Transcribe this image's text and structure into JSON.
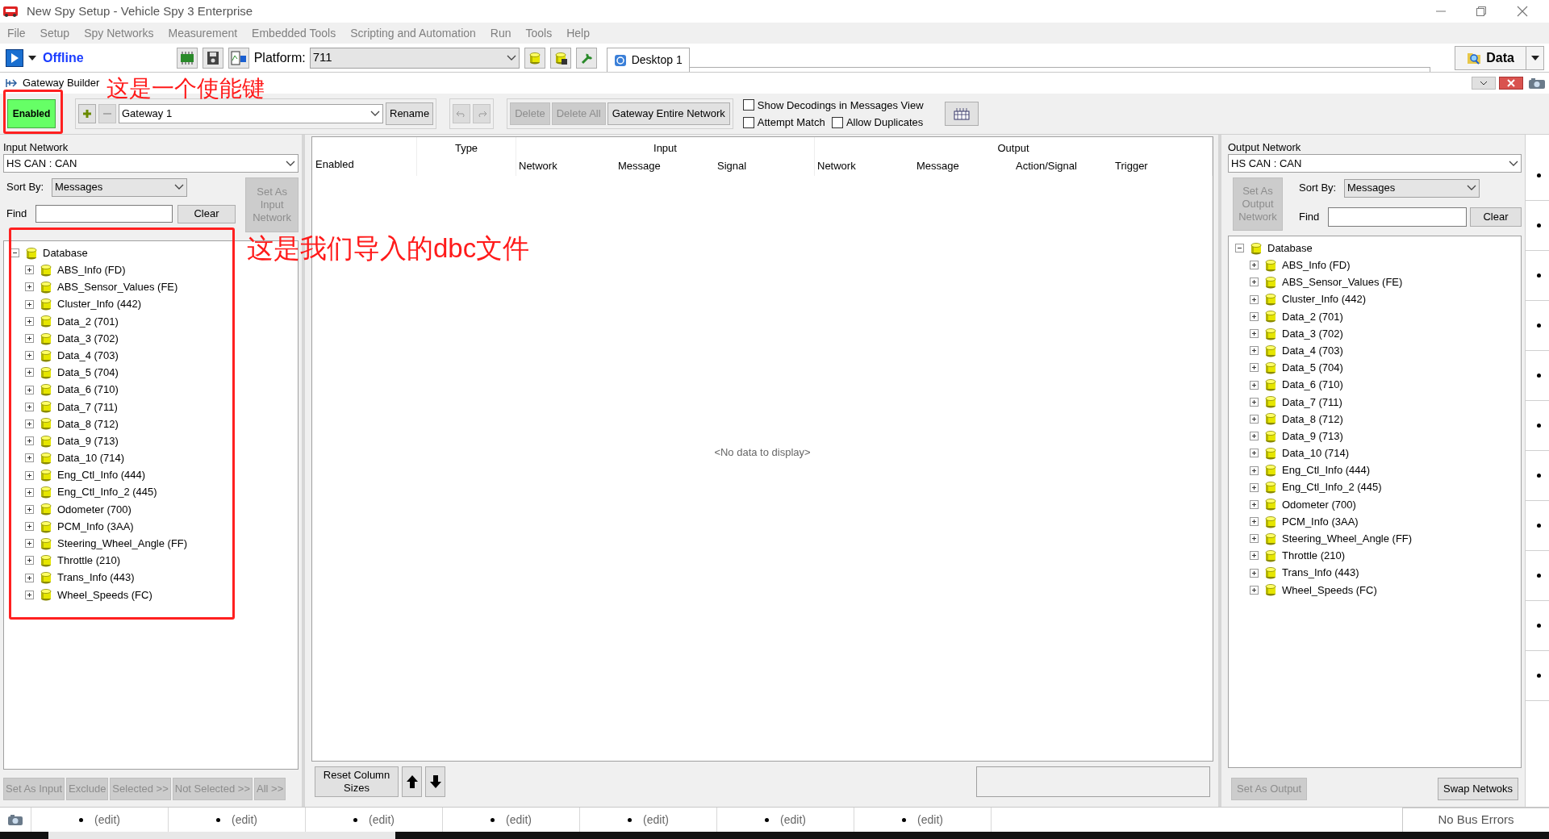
{
  "window": {
    "title": "New Spy Setup - Vehicle Spy 3 Enterprise"
  },
  "menu": [
    "File",
    "Setup",
    "Spy Networks",
    "Measurement",
    "Embedded Tools",
    "Scripting and Automation",
    "Run",
    "Tools",
    "Help"
  ],
  "toolbar": {
    "mode": "Offline",
    "platform_label": "Platform:",
    "platform": "711",
    "desktop_tab": "Desktop 1",
    "data_button": "Data"
  },
  "panel": {
    "title": "Gateway Builder"
  },
  "controls": {
    "enabled": {
      "label": "Enabled",
      "on": true
    },
    "gateway": "Gateway 1",
    "rename": "Rename",
    "buttons": [
      {
        "label": "Delete",
        "disabled": true
      },
      {
        "label": "Delete All",
        "disabled": true
      },
      {
        "label": "Gateway Entire Network",
        "disabled": false
      }
    ],
    "options": [
      {
        "label": "Show Decodings in Messages View",
        "checked": false
      },
      {
        "label": "Attempt Match",
        "checked": false
      },
      {
        "label": "Allow Duplicates",
        "checked": false
      }
    ]
  },
  "input_network": {
    "title": "Input Network",
    "network": "HS CAN : CAN",
    "sort_label": "Sort By:",
    "sort": "Messages",
    "set_button": {
      "label": "Set As Input Network",
      "disabled": true
    },
    "find_label": "Find",
    "clear": "Clear",
    "tree": {
      "label": "Database",
      "expanded": true,
      "children": [
        {
          "label": "ABS_Info (FD)",
          "expanded": false
        },
        {
          "label": "ABS_Sensor_Values (FE)",
          "expanded": false
        },
        {
          "label": "Cluster_Info (442)",
          "expanded": false
        },
        {
          "label": "Data_2 (701)",
          "expanded": false
        },
        {
          "label": "Data_3 (702)",
          "expanded": false
        },
        {
          "label": "Data_4 (703)",
          "expanded": false
        },
        {
          "label": "Data_5 (704)",
          "expanded": false
        },
        {
          "label": "Data_6 (710)",
          "expanded": false
        },
        {
          "label": "Data_7 (711)",
          "expanded": false
        },
        {
          "label": "Data_8 (712)",
          "expanded": false
        },
        {
          "label": "Data_9 (713)",
          "expanded": false
        },
        {
          "label": "Data_10 (714)",
          "expanded": false
        },
        {
          "label": "Eng_Ctl_Info (444)",
          "expanded": false
        },
        {
          "label": "Eng_Ctl_Info_2 (445)",
          "expanded": false
        },
        {
          "label": "Odometer (700)",
          "expanded": false
        },
        {
          "label": "PCM_Info (3AA)",
          "expanded": false
        },
        {
          "label": "Steering_Wheel_Angle (FF)",
          "expanded": false
        },
        {
          "label": "Throttle (210)",
          "expanded": false
        },
        {
          "label": "Trans_Info (443)",
          "expanded": false
        },
        {
          "label": "Wheel_Speeds (FC)",
          "expanded": false
        }
      ]
    },
    "buttons": [
      {
        "label": "Set As Input",
        "disabled": true
      },
      {
        "label": "Exclude",
        "disabled": true
      },
      {
        "label": "Selected >>",
        "disabled": true
      },
      {
        "label": "Not Selected >>",
        "disabled": true
      },
      {
        "label": "All >>",
        "disabled": true
      }
    ]
  },
  "grid": {
    "first_column": "Enabled",
    "groups": [
      {
        "label": "Type"
      },
      {
        "label": "Input",
        "columns": [
          "Network",
          "Message",
          "Signal"
        ]
      },
      {
        "label": "Output",
        "columns": [
          "Network",
          "Message",
          "Action/Signal",
          "Trigger"
        ]
      }
    ],
    "empty": "<No data to display>",
    "reset": "Reset Column Sizes"
  },
  "output_network": {
    "title": "Output Network",
    "network": "HS CAN : CAN",
    "set_button": {
      "label": "Set As Output Network",
      "disabled": true
    },
    "sort_label": "Sort By:",
    "sort": "Messages",
    "find_label": "Find",
    "clear": "Clear",
    "tree": {
      "label": "Database",
      "expanded": true,
      "children": [
        {
          "label": "ABS_Info (FD)",
          "expanded": false
        },
        {
          "label": "ABS_Sensor_Values (FE)",
          "expanded": false
        },
        {
          "label": "Cluster_Info (442)",
          "expanded": false
        },
        {
          "label": "Data_2 (701)",
          "expanded": false
        },
        {
          "label": "Data_3 (702)",
          "expanded": false
        },
        {
          "label": "Data_4 (703)",
          "expanded": false
        },
        {
          "label": "Data_5 (704)",
          "expanded": false
        },
        {
          "label": "Data_6 (710)",
          "expanded": false
        },
        {
          "label": "Data_7 (711)",
          "expanded": false
        },
        {
          "label": "Data_8 (712)",
          "expanded": false
        },
        {
          "label": "Data_9 (713)",
          "expanded": false
        },
        {
          "label": "Data_10 (714)",
          "expanded": false
        },
        {
          "label": "Eng_Ctl_Info (444)",
          "expanded": false
        },
        {
          "label": "Eng_Ctl_Info_2 (445)",
          "expanded": false
        },
        {
          "label": "Odometer (700)",
          "expanded": false
        },
        {
          "label": "PCM_Info (3AA)",
          "expanded": false
        },
        {
          "label": "Steering_Wheel_Angle (FF)",
          "expanded": false
        },
        {
          "label": "Throttle (210)",
          "expanded": false
        },
        {
          "label": "Trans_Info (443)",
          "expanded": false
        },
        {
          "label": "Wheel_Speeds (FC)",
          "expanded": false
        }
      ]
    },
    "buttons": [
      {
        "label": "Set As Output",
        "disabled": true
      },
      {
        "label": "Swap Netwoks",
        "disabled": false
      }
    ]
  },
  "status_bar": {
    "cells": [
      "(edit)",
      "(edit)",
      "(edit)",
      "(edit)",
      "(edit)",
      "(edit)",
      "(edit)"
    ],
    "bus": "No Bus Errors"
  },
  "annotations": [
    {
      "text": "这是一个使能键"
    },
    {
      "text": "这是我们导入的dbc文件"
    }
  ]
}
